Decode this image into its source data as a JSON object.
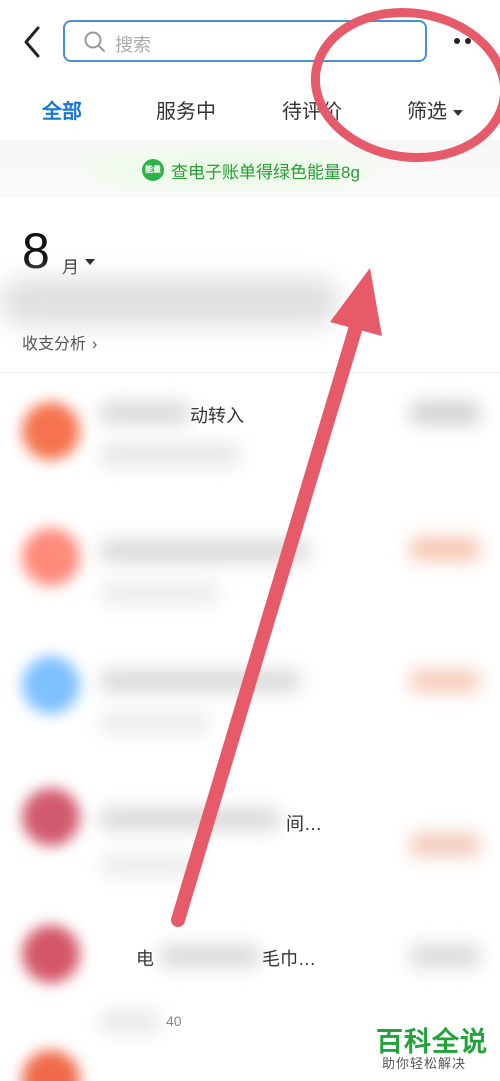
{
  "header": {
    "search_placeholder": "搜索"
  },
  "tabs": [
    {
      "label": "全部",
      "active": true
    },
    {
      "label": "服务中",
      "active": false
    },
    {
      "label": "待评价",
      "active": false
    },
    {
      "label": "筛选",
      "active": false
    }
  ],
  "promo": {
    "badge": "能量",
    "text": "查电子账单得绿色能量8g"
  },
  "month": {
    "number": "8",
    "unit": "月",
    "analysis": "收支分析"
  },
  "list": [
    {
      "partial_text": "动转入",
      "sub": ""
    },
    {
      "partial_text": "",
      "sub": ""
    },
    {
      "partial_text": "",
      "sub": ""
    },
    {
      "partial_text": "间…",
      "sub": ""
    },
    {
      "partial_text": "电",
      "partial_text2": "毛巾…",
      "sub": "40"
    }
  ],
  "annotation": {
    "circle_color": "#e65a6a",
    "arrow_color": "#e65a6a"
  },
  "watermark": {
    "title": "百科全说",
    "subtitle": "助你轻松解决"
  },
  "colors": {
    "accent": "#1677d6",
    "green": "#2fb24a"
  }
}
